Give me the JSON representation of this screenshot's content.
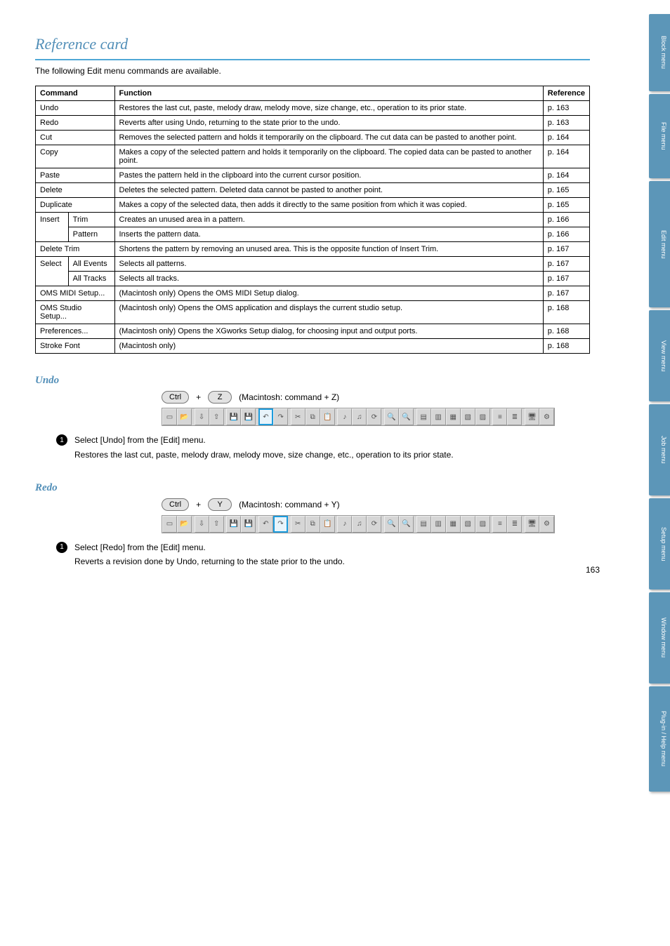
{
  "header": {
    "title": "Reference card"
  },
  "intro": "The following Edit menu commands are available.",
  "table": {
    "cols": [
      "Command",
      "Function",
      "Reference"
    ],
    "rows": [
      {
        "c0": "Undo",
        "c1": "Restores the last cut, paste, melody draw, melody move, size change, etc., operation to its prior state.",
        "c2": "p. 163"
      },
      {
        "c0": "Redo",
        "c1": "Reverts after using Undo, returning to the state prior to the undo.",
        "c2": "p. 163"
      },
      {
        "c0": "Cut",
        "c1": "Removes the selected pattern and holds it temporarily on the clipboard. The cut data can be pasted to another point.",
        "c2": "p. 164"
      },
      {
        "c0": "Copy",
        "c1": "Makes a copy of the selected pattern and holds it temporarily on the clipboard. The copied data can be pasted to another point.",
        "c2": "p. 164"
      },
      {
        "c0": "Paste",
        "c1": "Pastes the pattern held in the clipboard into the current cursor position.",
        "c2": "p. 164"
      },
      {
        "c0": "Delete",
        "c1": "Deletes the selected pattern. Deleted data cannot be pasted to another point.",
        "c2": "p. 165"
      },
      {
        "c0": "Duplicate",
        "c1": "Makes a copy of the selected data, then adds it directly to the same position from which it was copied.",
        "c2": "p. 165"
      },
      {
        "c0": "Insert",
        "ssub": "Trim",
        "c1": "Creates an unused area in a pattern.",
        "c2": "p. 166"
      },
      {
        "c0": "",
        "ssub": "Pattern",
        "c1": "Inserts the pattern data.",
        "c2": "p. 166"
      },
      {
        "c0": "Delete Trim",
        "c1": "Shortens the pattern by removing an unused area. This is the opposite function of Insert Trim.",
        "c2": "p. 167"
      },
      {
        "c0": "Select",
        "ssub": "All Events",
        "c1": "Selects all patterns.",
        "c2": "p. 167"
      },
      {
        "c0": "",
        "ssub": "All Tracks",
        "c1": "Selects all tracks.",
        "c2": "p. 167"
      },
      {
        "c0": "OMS MIDI Setup...",
        "c1": "(Macintosh only) Opens the OMS MIDI Setup dialog.",
        "c2": "p. 167"
      },
      {
        "c0": "OMS Studio Setup...",
        "c1": "(Macintosh only) Opens the OMS application and displays the current studio setup.",
        "c2": "p. 168"
      },
      {
        "c0": "Preferences...",
        "c1": "(Macintosh only) Opens the XGworks Setup dialog, for choosing input and output ports.",
        "c2": "p. 168"
      },
      {
        "c0": "Stroke Font",
        "c1": "(Macintosh only)",
        "c2": "p. 168"
      }
    ]
  },
  "undo": {
    "heading": "Undo",
    "shortcut": {
      "k1": "Ctrl",
      "k2": "Z",
      "mac": "(Macintosh: command + Z)"
    },
    "step_label": "Select [Undo] from the [Edit] menu.",
    "note": "Restores the last cut, paste, melody draw, melody move, size change, etc., operation to its prior state."
  },
  "redo": {
    "heading": "Redo",
    "shortcut": {
      "k1": "Ctrl",
      "k2": "Y",
      "mac": "(Macintosh: command + Y)"
    },
    "step_label": "Select [Redo] from the [Edit] menu.",
    "note": "Reverts a revision done by Undo, returning to the state prior to the undo."
  },
  "tabs": [
    "Block menu",
    "File menu",
    "Edit menu",
    "View menu",
    "Job menu",
    "Setup menu",
    "Window menu",
    "Plug-in / Help menu"
  ],
  "page_number": "163"
}
